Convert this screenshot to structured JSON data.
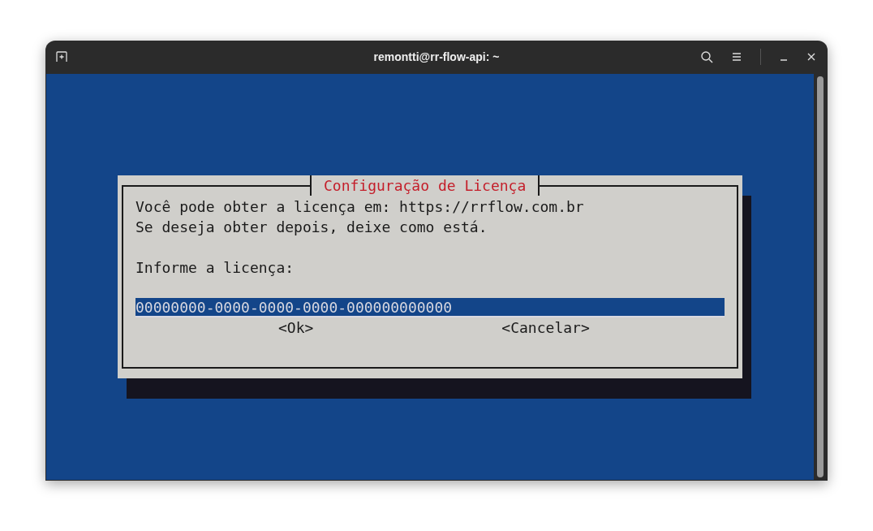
{
  "window": {
    "title": "remontti@rr-flow-api: ~"
  },
  "dialog": {
    "title": "Configuração de Licença",
    "lines": [
      "Você pode obter a licença em: https://rrflow.com.br",
      "Se deseja obter depois, deixe como está."
    ],
    "prompt": "Informe a licença:",
    "field": {
      "value": "00000000-0000-0000-0000-000000000000"
    },
    "buttons": [
      {
        "label": "<Ok>",
        "selected": false
      },
      {
        "label": "<Cancelar>",
        "selected": false
      }
    ]
  }
}
